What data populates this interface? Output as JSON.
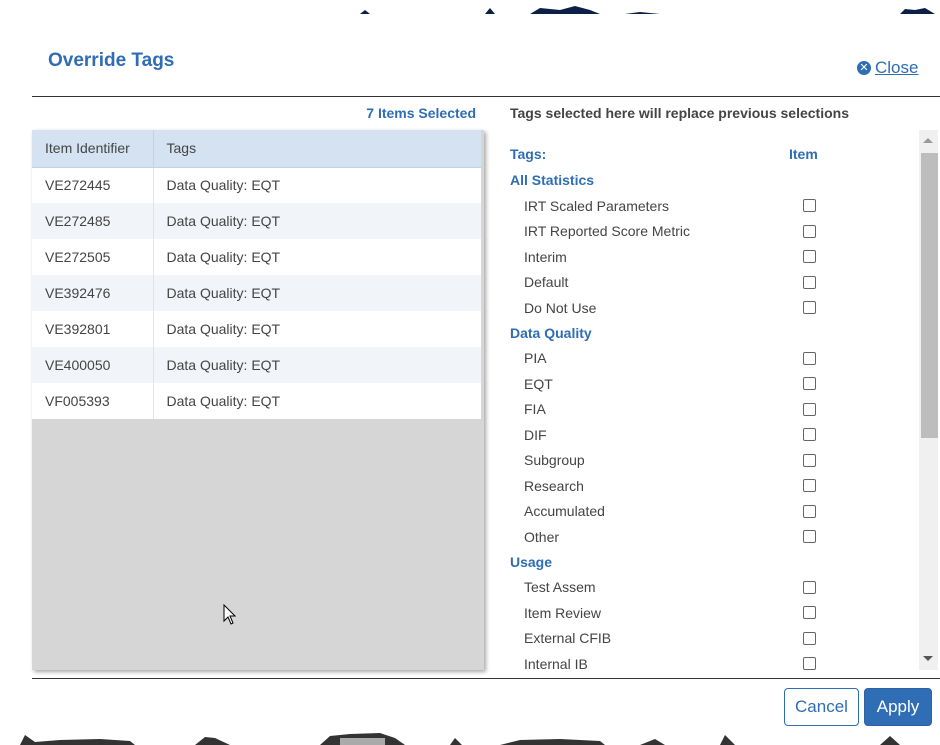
{
  "dialog": {
    "title": "Override Tags",
    "close_label": "Close",
    "items_selected": "7 Items Selected",
    "replace_note": "Tags selected here will replace previous selections"
  },
  "table": {
    "columns": [
      "Item Identifier",
      "Tags"
    ],
    "rows": [
      {
        "id": "VE272445",
        "tags": "Data Quality: EQT"
      },
      {
        "id": "VE272485",
        "tags": "Data Quality: EQT"
      },
      {
        "id": "VE272505",
        "tags": "Data Quality: EQT"
      },
      {
        "id": "VE392476",
        "tags": "Data Quality: EQT"
      },
      {
        "id": "VE392801",
        "tags": "Data Quality: EQT"
      },
      {
        "id": "VE400050",
        "tags": "Data Quality: EQT"
      },
      {
        "id": "VF005393",
        "tags": "Data Quality: EQT"
      }
    ]
  },
  "tags_panel": {
    "tags_header": "Tags:",
    "item_header": "Item",
    "groups": [
      {
        "name": "All Statistics",
        "tags": [
          {
            "label": "IRT Scaled Parameters",
            "checked": false
          },
          {
            "label": "IRT Reported Score Metric",
            "checked": false
          },
          {
            "label": "Interim",
            "checked": false
          },
          {
            "label": "Default",
            "checked": false
          },
          {
            "label": "Do Not Use",
            "checked": false
          }
        ]
      },
      {
        "name": "Data Quality",
        "tags": [
          {
            "label": "PIA",
            "checked": false
          },
          {
            "label": "EQT",
            "checked": false
          },
          {
            "label": "FIA",
            "checked": false
          },
          {
            "label": "DIF",
            "checked": false
          },
          {
            "label": "Subgroup",
            "checked": false
          },
          {
            "label": "Research",
            "checked": false
          },
          {
            "label": "Accumulated",
            "checked": false
          },
          {
            "label": "Other",
            "checked": false
          }
        ]
      },
      {
        "name": "Usage",
        "tags": [
          {
            "label": "Test Assem",
            "checked": false
          },
          {
            "label": "Item Review",
            "checked": false
          },
          {
            "label": "External CFIB",
            "checked": false
          },
          {
            "label": "Internal IB",
            "checked": false
          }
        ]
      }
    ]
  },
  "footer": {
    "cancel_label": "Cancel",
    "apply_label": "Apply"
  },
  "colors": {
    "accent": "#2f6db5",
    "table_header_bg": "#d4e2f1",
    "row_alt_bg": "#f1f4f9",
    "panel_empty_bg": "#d6d6d6"
  }
}
